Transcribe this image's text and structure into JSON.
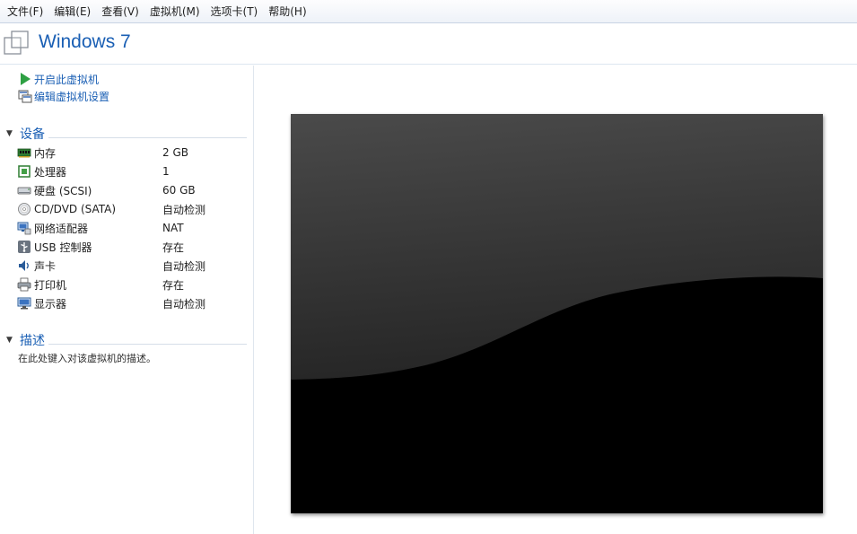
{
  "menu": [
    "文件(F)",
    "编辑(E)",
    "查看(V)",
    "虚拟机(M)",
    "选项卡(T)",
    "帮助(H)"
  ],
  "vm_title": "Windows 7",
  "actions": {
    "power_on": "开启此虚拟机",
    "edit_settings": "编辑虚拟机设置"
  },
  "devices_header": "设备",
  "devices": [
    {
      "name": "内存",
      "value": "2 GB",
      "icon": "memory-icon"
    },
    {
      "name": "处理器",
      "value": "1",
      "icon": "processor-icon"
    },
    {
      "name": "硬盘 (SCSI)",
      "value": "60 GB",
      "icon": "hard-disk-icon"
    },
    {
      "name": "CD/DVD (SATA)",
      "value": "自动检测",
      "icon": "cd-dvd-icon"
    },
    {
      "name": "网络适配器",
      "value": "NAT",
      "icon": "network-adapter-icon"
    },
    {
      "name": "USB 控制器",
      "value": "存在",
      "icon": "usb-icon"
    },
    {
      "name": "声卡",
      "value": "自动检测",
      "icon": "sound-card-icon"
    },
    {
      "name": "打印机",
      "value": "存在",
      "icon": "printer-icon"
    },
    {
      "name": "显示器",
      "value": "自动检测",
      "icon": "display-icon"
    }
  ],
  "description_header": "描述",
  "description_placeholder": "在此处键入对该虚拟机的描述。",
  "colors": {
    "accent": "#1a5fb4",
    "play_green": "#2ea043"
  }
}
